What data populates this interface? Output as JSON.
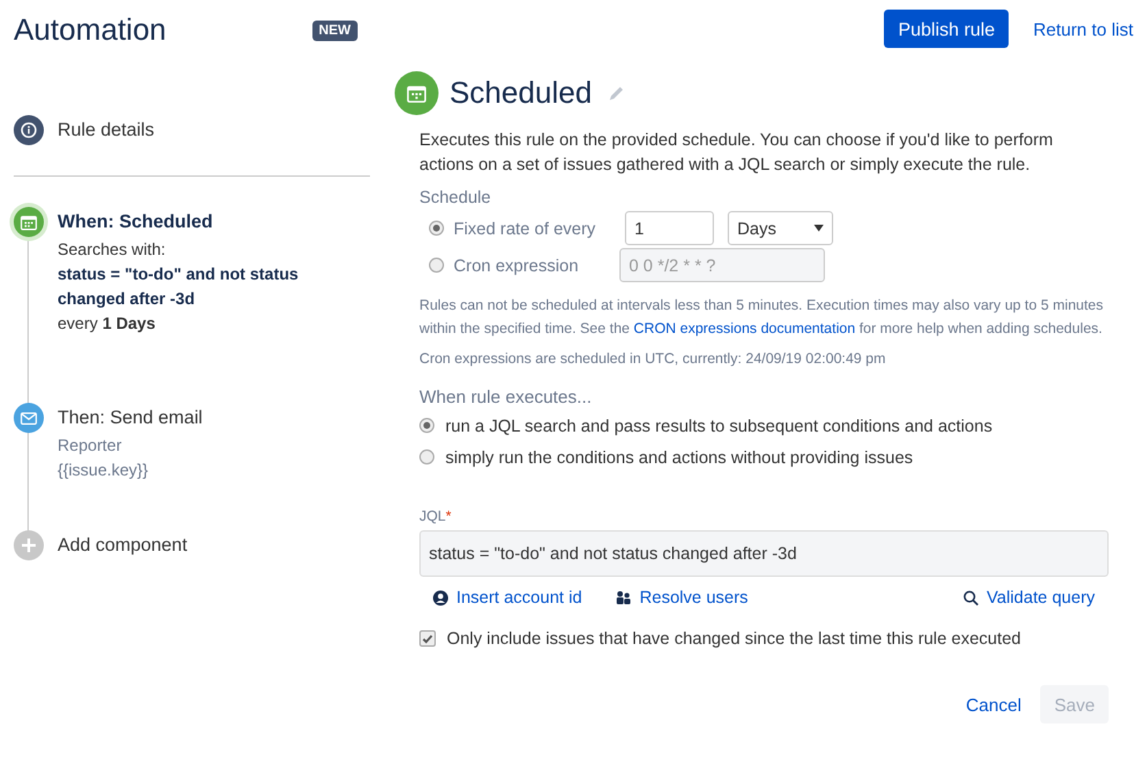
{
  "header": {
    "title": "Automation",
    "badge": "NEW",
    "publish_button": "Publish rule",
    "return_link": "Return to list"
  },
  "steps": [
    {
      "kind": "details",
      "title": "Rule details",
      "selected": false
    },
    {
      "kind": "trigger",
      "title": "When: Scheduled",
      "selected": true,
      "lines": [
        {
          "text": "Searches with:",
          "bold": false
        },
        {
          "text": "status = \"to-do\" and not status changed after -3d",
          "bold": true
        },
        {
          "text": "every **1 Days**",
          "bold": false
        }
      ]
    },
    {
      "kind": "action",
      "title": "Then: Send email",
      "selected": false,
      "lines": [
        {
          "text": "Reporter",
          "bold": false
        },
        {
          "text": "{{issue.key}}",
          "bold": false
        }
      ]
    },
    {
      "kind": "add",
      "title": "Add component",
      "selected": false
    }
  ],
  "editor": {
    "title": "Scheduled",
    "description": "Executes this rule on the provided schedule. You can choose if you'd like to perform actions on a set of issues gathered with a JQL search or simply execute the rule.",
    "schedule_label": "Schedule",
    "schedule_options": [
      {
        "kind": "fixed",
        "label": "Fixed rate of every",
        "selected": true,
        "value": "1",
        "unit": "Days"
      },
      {
        "kind": "cron",
        "label": "Cron expression",
        "selected": false,
        "placeholder": "0 0 */2 * * ?",
        "disabled": true
      }
    ],
    "note": {
      "before": "Rules can not be scheduled at intervals less than 5 minutes. Execution times may also vary up to 5 minutes within the specified time. See the ",
      "link": "CRON expressions documentation",
      "after": " for more help when adding schedules."
    },
    "utc_note": "Cron expressions are scheduled in UTC, currently: 24/09/19 02:00:49 pm",
    "execute_label": "When rule executes...",
    "execute_options": [
      {
        "label": "run a JQL search and pass results to subsequent conditions and actions",
        "selected": true
      },
      {
        "label": "simply run the conditions and actions without providing issues",
        "selected": false
      }
    ],
    "jql": {
      "label": "JQL",
      "required_mark": "*",
      "value": "status = \"to-do\" and not status changed after -3d"
    },
    "links": [
      {
        "kind": "account",
        "label": "Insert account id"
      },
      {
        "kind": "users",
        "label": "Resolve users"
      },
      {
        "kind": "search",
        "label": "Validate query"
      }
    ],
    "checkbox": {
      "label": "Only include issues that have changed since the last time this rule executed",
      "checked": true
    },
    "cancel_button": "Cancel",
    "save_button": {
      "label": "Save",
      "disabled": true
    }
  }
}
